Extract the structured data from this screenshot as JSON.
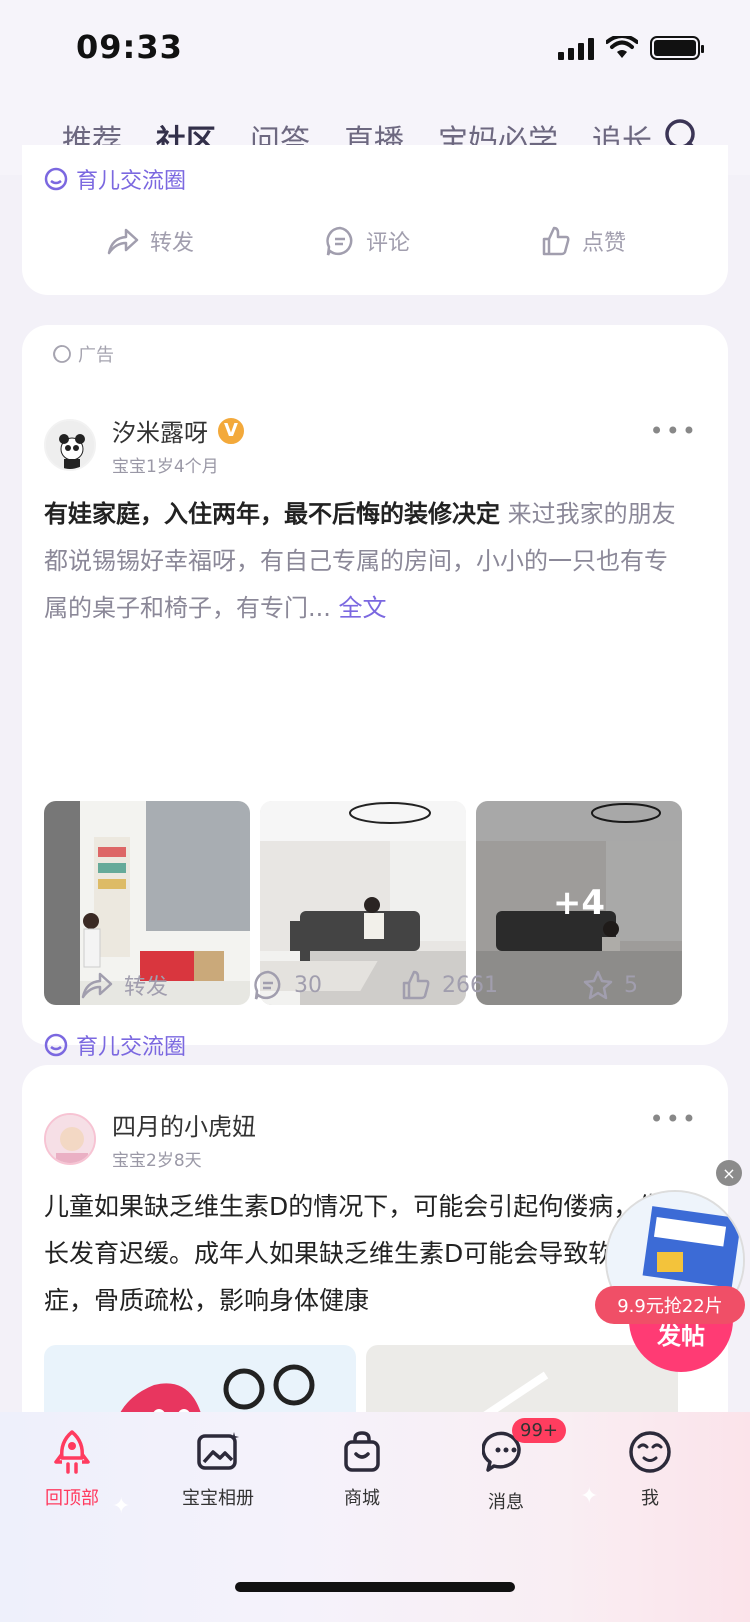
{
  "status": {
    "time": "09:33"
  },
  "topnav": {
    "tabs": [
      "推荐",
      "社区",
      "问答",
      "直播",
      "宝妈必学",
      "追长"
    ],
    "active_index": 1
  },
  "prev_post": {
    "circle": "育儿交流圈",
    "share": "转发",
    "comment": "评论",
    "like": "点赞"
  },
  "ad_post": {
    "ad_label": "广告",
    "author": "汐米露呀",
    "author_badge": "V",
    "baby_age": "宝宝1岁4个月",
    "title": "有娃家庭，入住两年，最不后悔的装修决定",
    "body": "来过我家的朋友都说锡锡好幸福呀，有自己专属的房间，小小的一只也有专属的桌子和椅子，有专门...",
    "full_text": "全文",
    "extra_images": "+4",
    "circle": "育儿交流圈",
    "share": "转发",
    "comments": "30",
    "likes": "2661",
    "favorites": "5"
  },
  "post3": {
    "author": "四月的小虎妞",
    "baby_age": "宝宝2岁8天",
    "body": "儿童如果缺乏维生素D的情况下，可能会引起佝偻病，生长发育迟缓。成年人如果缺乏维生素D可能会导致软骨症，骨质疏松，影响身体健康"
  },
  "floating_ad": {
    "price": "9.9元抢22片",
    "post_button": "发帖"
  },
  "tabbar": {
    "items": [
      "回顶部",
      "宝宝相册",
      "商城",
      "消息",
      "我"
    ],
    "message_badge": "99+",
    "active_color": "#ff3b5f"
  }
}
